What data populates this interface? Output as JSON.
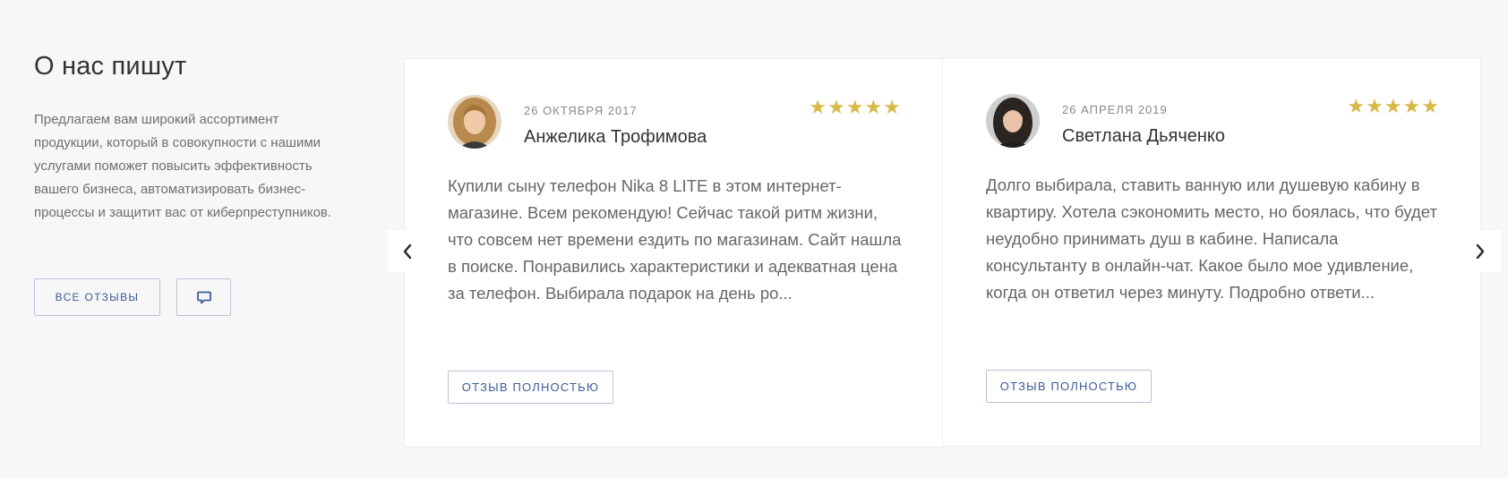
{
  "intro": {
    "title": "О нас пишут",
    "description": "Предлагаем вам широкий ассортимент продукции, который в совокупности с нашими услугами поможет повысить эффективность вашего бизнеса, автоматизировать бизнес- процессы и защитит вас от киберпреступников.",
    "all_reviews_label": "ВСЕ ОТЗЫВЫ"
  },
  "reviews": [
    {
      "date": "26 ОКТЯБРЯ 2017",
      "author": "Анжелика Трофимова",
      "rating": 5,
      "stars": "★★★★★",
      "text": "Купили сыну телефон Nika 8 LITE в этом интернет-магазине. Всем рекомендую! Сейчас такой ритм жизни, что совсем нет времени ездить по магазинам. Сайт нашла в поиске. Понравились характеристики и адекватная цена за телефон. Выбирала подарок на день ро...",
      "button_label": "ОТЗЫВ ПОЛНОСТЬЮ"
    },
    {
      "date": "26 АПРЕЛЯ 2019",
      "author": "Светлана Дьяченко",
      "rating": 5,
      "stars": "★★★★★",
      "text": "Долго выбирала, ставить ванную или душевую кабину в квартиру. Хотела сэкономить место, но боялась, что будет неудобно принимать душ в кабине. Написала консультанту в онлайн-чат. Какое было мое удивление, когда он ответил через минуту. Подробно ответи...",
      "button_label": "ОТЗЫВ ПОЛНОСТЬЮ"
    }
  ],
  "colors": {
    "accent": "#3c5a99",
    "star": "#d9b84a",
    "background": "#f7f7f7"
  },
  "icons": {
    "chat": "chat-bubble-icon",
    "prev": "chevron-left-icon",
    "next": "chevron-right-icon"
  }
}
